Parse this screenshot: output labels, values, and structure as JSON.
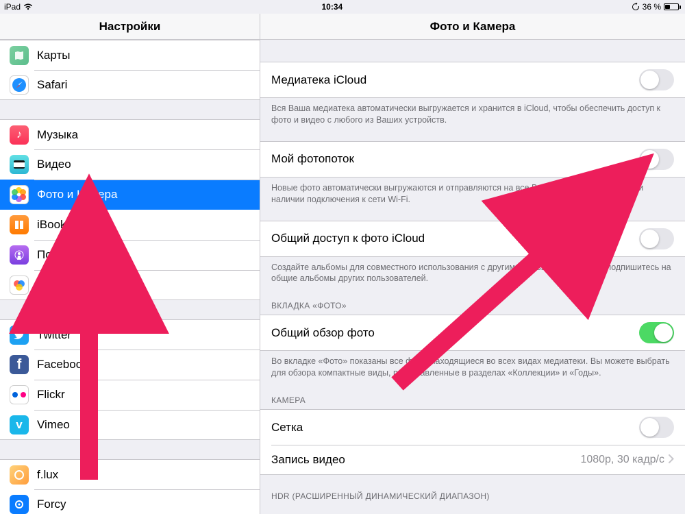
{
  "status": {
    "device": "iPad",
    "time": "10:34",
    "battery_text": "36 %",
    "battery_pct": 36
  },
  "sidebar": {
    "title": "Настройки",
    "groups": [
      {
        "items": [
          {
            "id": "maps",
            "label": "Карты",
            "icon": "maps-icon"
          },
          {
            "id": "safari",
            "label": "Safari",
            "icon": "safari-icon"
          }
        ]
      },
      {
        "items": [
          {
            "id": "music",
            "label": "Музыка",
            "icon": "music-icon"
          },
          {
            "id": "video",
            "label": "Видео",
            "icon": "video-icon"
          },
          {
            "id": "photos",
            "label": "Фото и Камера",
            "icon": "photos-icon",
            "selected": true
          },
          {
            "id": "ibooks",
            "label": "iBooks",
            "icon": "ibooks-icon"
          },
          {
            "id": "podcasts",
            "label": "Подкасты",
            "icon": "podcasts-icon"
          },
          {
            "id": "gamecenter",
            "label": "Game Center",
            "icon": "gamecenter-icon"
          }
        ]
      },
      {
        "items": [
          {
            "id": "twitter",
            "label": "Twitter",
            "icon": "twitter-icon"
          },
          {
            "id": "facebook",
            "label": "Facebook",
            "icon": "facebook-icon"
          },
          {
            "id": "flickr",
            "label": "Flickr",
            "icon": "flickr-icon"
          },
          {
            "id": "vimeo",
            "label": "Vimeo",
            "icon": "vimeo-icon"
          }
        ]
      },
      {
        "items": [
          {
            "id": "flux",
            "label": "f.lux",
            "icon": "flux-icon"
          },
          {
            "id": "forcy",
            "label": "Forcy",
            "icon": "forcy-icon"
          }
        ]
      }
    ]
  },
  "detail": {
    "title": "Фото и Камера",
    "icloud_library": {
      "label": "Медиатека iCloud",
      "on": false,
      "footnote": "Вся Ваша медиатека автоматически выгружается и хранится в iCloud, чтобы обеспечить доступ к фото и видео с любого из Ваших устройств."
    },
    "photo_stream": {
      "label": "Мой фотопоток",
      "on": false,
      "footnote": "Новые фото автоматически выгружаются и отправляются на все Ваши устройства iCloud при наличии подключения к сети Wi-Fi."
    },
    "icloud_sharing": {
      "label": "Общий доступ к фото iCloud",
      "on": false,
      "footnote": "Создайте альбомы для совместного использования с другими пользователями или подпишитесь на общие альбомы других пользователей."
    },
    "tab_header": "ВКЛАДКА «ФОТО»",
    "overview": {
      "label": "Общий обзор фото",
      "on": true,
      "footnote": "Во вкладке «Фото» показаны все фото, находящиеся во всех видах медиатеки. Вы можете выбрать для обзора компактные виды, представленные в разделах «Коллекции» и «Годы»."
    },
    "camera_header": "КАМЕРА",
    "grid": {
      "label": "Сетка",
      "on": false
    },
    "record_video": {
      "label": "Запись видео",
      "value": "1080p, 30 кадр/с"
    },
    "hdr_header": "HDR (РАСШИРЕННЫЙ ДИНАМИЧЕСКИЙ ДИАПАЗОН)"
  },
  "annotation": {
    "color": "#ed1e5b"
  }
}
